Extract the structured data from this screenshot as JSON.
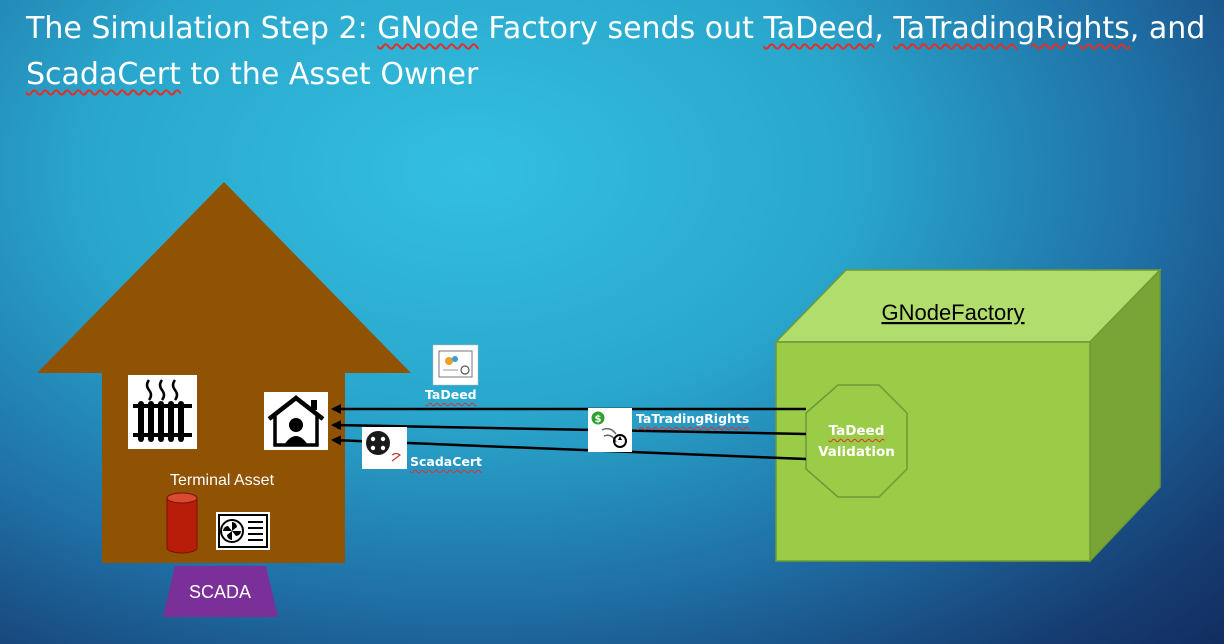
{
  "title": {
    "p1": "The Simulation Step 2: ",
    "gnode": "GNode",
    "p2": " Factory sends out ",
    "tadeed": "TaDeed",
    "p3": ", ",
    "tatrading": "TaTradingRights",
    "p4": ", and ",
    "scadacert": "ScadaCert",
    "p5": " to the Asset Owner"
  },
  "house": {
    "terminal_label": "Terminal Asset",
    "scada_label": "SCADA"
  },
  "factory": {
    "label": "GNodeFactory",
    "validation_line1": "TaDeed",
    "validation_line2": "Validation"
  },
  "tokens": {
    "tadeed": "TaDeed",
    "tatradingrights": "TaTradingRights",
    "scadacert": "ScadaCert"
  },
  "colors": {
    "house": "#8f5303",
    "factory_front": "#9bcc48",
    "factory_top": "#b1dd6c",
    "factory_side": "#79a536",
    "scada": "#7b2f98",
    "tank": "#b81d0a"
  }
}
